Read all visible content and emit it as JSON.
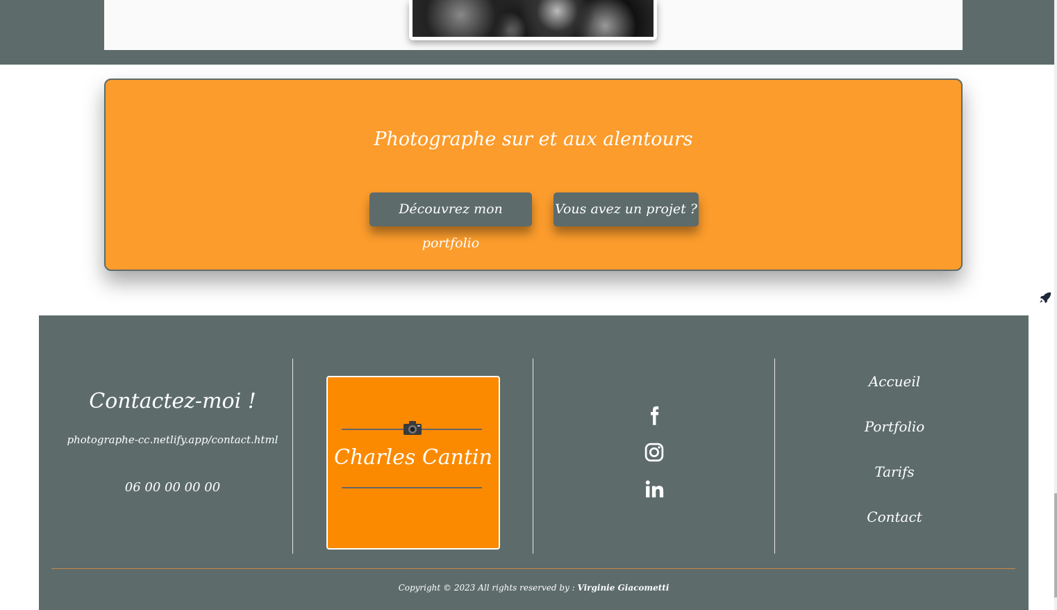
{
  "cta": {
    "title": "Photographe sur et aux alentours",
    "portfolio_button": "Découvrez mon portfolio",
    "project_button": "Vous avez un projet ?"
  },
  "footer": {
    "contact_title": "Contactez-moi !",
    "contact_url": "photographe-cc.netlify.app/contact.html",
    "phone": "06 00 00 00 00",
    "logo_name": "Charles Cantin",
    "nav": [
      "Accueil",
      "Portfolio",
      "Tarifs",
      "Contact"
    ],
    "copyright_prefix": "Copyright © 2023 All rights reserved by :",
    "copyright_author": "Virginie Giacometti"
  },
  "icons": [
    "rocket-icon",
    "camera-icon",
    "facebook-icon",
    "instagram-icon",
    "linkedin-icon"
  ],
  "colors": {
    "slate": "#5d6b6b",
    "orange": "#fb9c2c",
    "logo_orange": "#fb8a00"
  }
}
